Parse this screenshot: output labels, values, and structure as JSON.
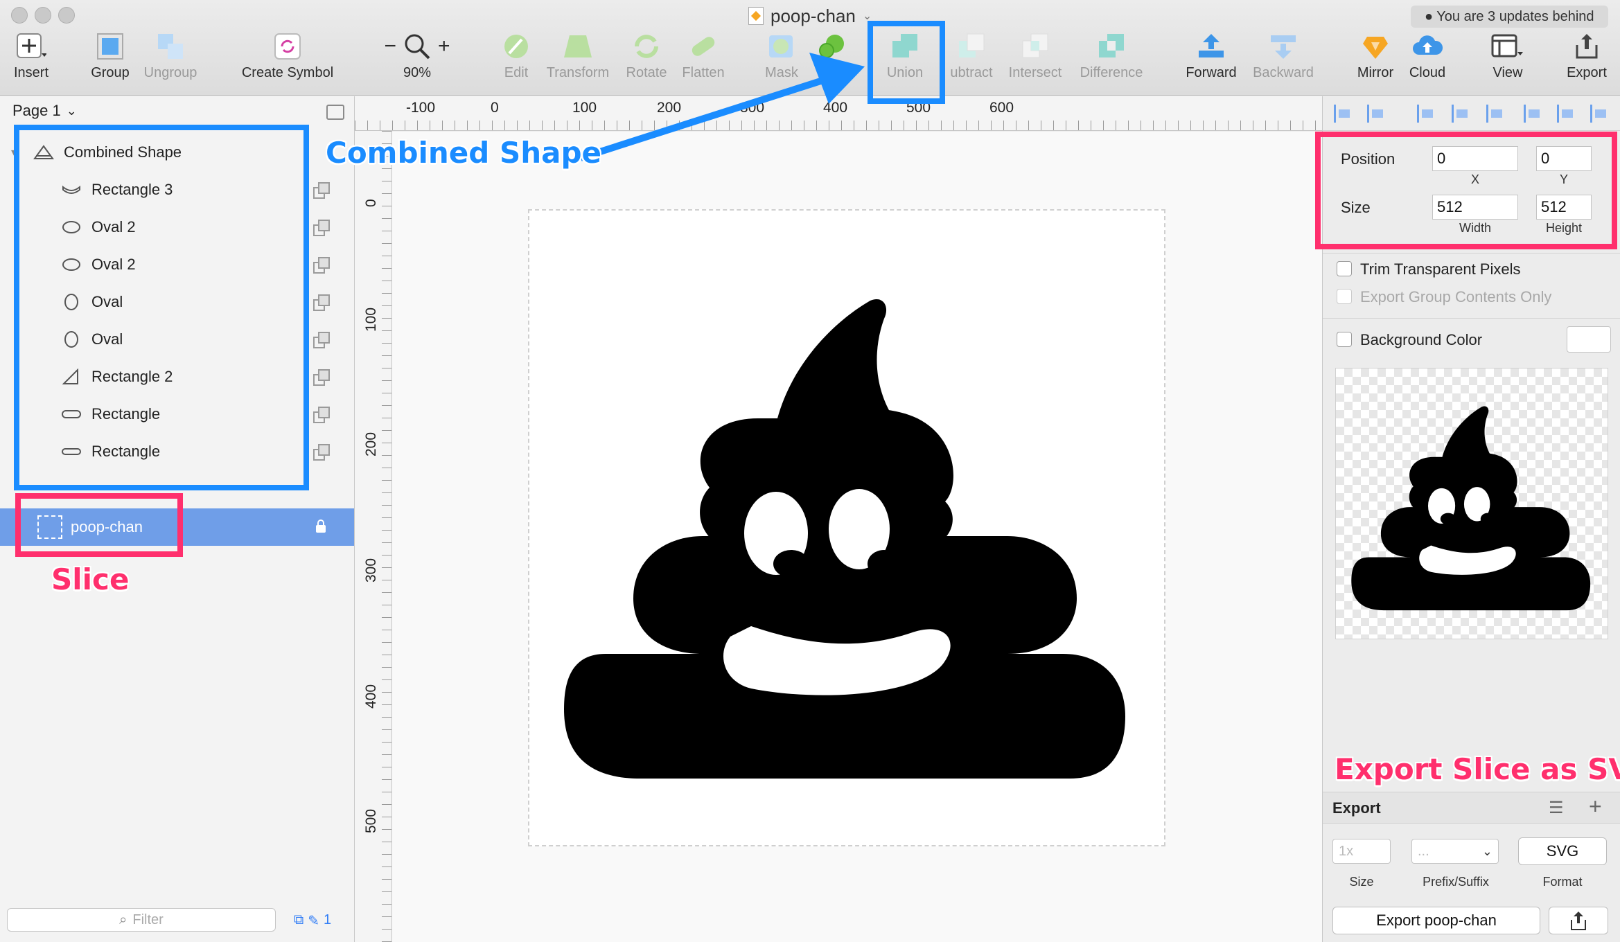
{
  "window": {
    "title": "poop-chan",
    "update_notice": "You are 3 updates behind"
  },
  "toolbar": {
    "insert": "Insert",
    "group": "Group",
    "ungroup": "Ungroup",
    "create_symbol": "Create Symbol",
    "zoom": "90%",
    "edit": "Edit",
    "transform": "Transform",
    "rotate": "Rotate",
    "flatten": "Flatten",
    "mask": "Mask",
    "union": "Union",
    "subtract": "ubtract",
    "intersect": "Intersect",
    "difference": "Difference",
    "forward": "Forward",
    "backward": "Backward",
    "mirror": "Mirror",
    "cloud": "Cloud",
    "view": "View",
    "export": "Export"
  },
  "layers": {
    "page": "Page 1",
    "group_name": "Combined Shape",
    "items": [
      {
        "label": "Rectangle 3",
        "icon": "subtract-shape-icon"
      },
      {
        "label": "Oval 2",
        "icon": "oval-icon"
      },
      {
        "label": "Oval 2",
        "icon": "oval-icon"
      },
      {
        "label": "Oval",
        "icon": "oval-icon"
      },
      {
        "label": "Oval",
        "icon": "oval-icon"
      },
      {
        "label": "Rectangle 2",
        "icon": "triangle-icon"
      },
      {
        "label": "Rectangle",
        "icon": "rounded-rect-icon"
      },
      {
        "label": "Rectangle",
        "icon": "rounded-rect-icon"
      }
    ],
    "slice_name": "poop-chan",
    "filter_placeholder": "Filter",
    "filter_count": "1"
  },
  "rulers": {
    "top": [
      "-100",
      "0",
      "100",
      "200",
      "300",
      "400",
      "500",
      "600"
    ],
    "left": [
      "0",
      "100",
      "200",
      "300",
      "400",
      "500"
    ]
  },
  "inspector": {
    "position_label": "Position",
    "size_label": "Size",
    "x": "0",
    "y": "0",
    "x_caption": "X",
    "y_caption": "Y",
    "width": "512",
    "height": "512",
    "width_caption": "Width",
    "height_caption": "Height",
    "trim": "Trim Transparent Pixels",
    "export_group_only": "Export Group Contents Only",
    "background_color": "Background Color",
    "export_title": "Export",
    "export_size_placeholder": "1x",
    "export_prefix_placeholder": "...",
    "export_format": "SVG",
    "size_caption": "Size",
    "prefix_caption": "Prefix/Suffix",
    "format_caption": "Format",
    "export_button": "Export poop-chan"
  },
  "annotations": {
    "combined_shape": "Combined Shape",
    "slice": "Slice",
    "export_slice": "Export Slice as SVG"
  },
  "colors": {
    "annotation_blue": "#1a8cff",
    "annotation_pink": "#ff2f6d",
    "selection": "#6f9ee8"
  }
}
